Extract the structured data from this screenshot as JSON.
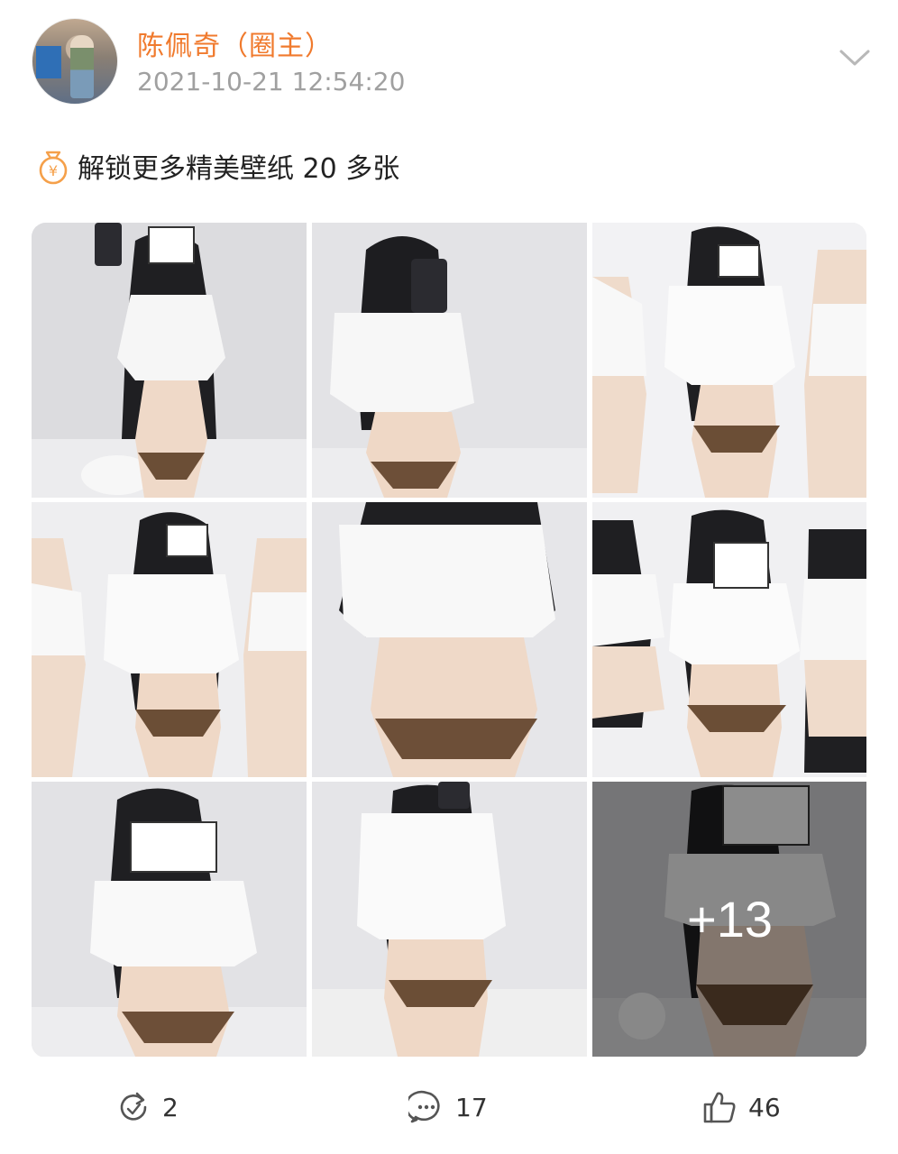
{
  "post": {
    "author": "陈佩奇（圈主）",
    "timestamp": "2021-10-21 12:54:20",
    "text": "解锁更多精美壁纸 20 多张",
    "more_images": "+13"
  },
  "actions": {
    "repost_count": "2",
    "comment_count": "17",
    "like_count": "46"
  },
  "colors": {
    "author_name": "#f07a2d",
    "timestamp": "#a0a0a0",
    "icon_bag": "#f5a04a"
  },
  "icons": {
    "dropdown": "chevron-down-icon",
    "text_prefix": "money-bag-icon",
    "repost": "repost-icon",
    "comment": "comment-icon",
    "like": "thumbs-up-icon"
  }
}
